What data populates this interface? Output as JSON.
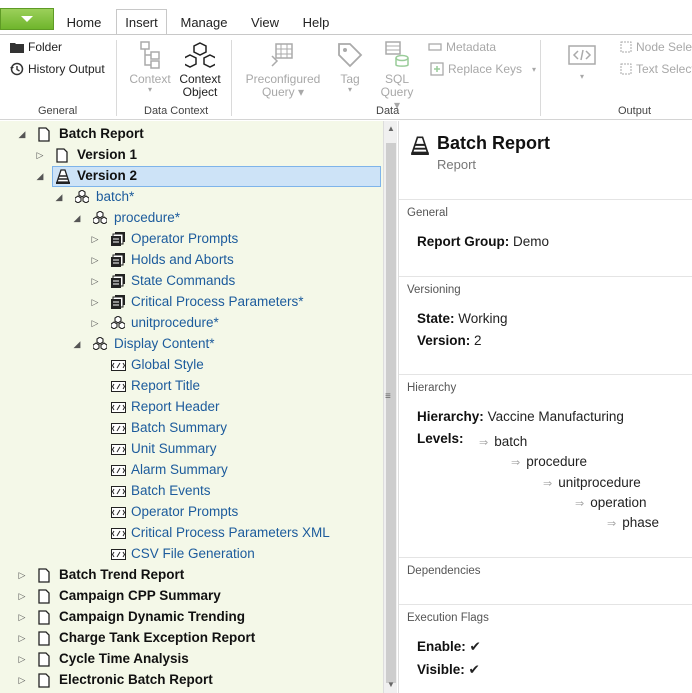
{
  "tabs": {
    "home": "Home",
    "insert": "Insert",
    "manage": "Manage",
    "view": "View",
    "help": "Help"
  },
  "ribbon": {
    "general": {
      "folder": "Folder",
      "history_output": "History Output",
      "label": "General"
    },
    "data_context": {
      "context_line1": "Context",
      "context_object_line1": "Context",
      "context_object_line2": "Object",
      "label": "Data Context"
    },
    "data": {
      "preconfigured_line1": "Preconfigured",
      "preconfigured_line2": "Query",
      "tag": "Tag",
      "sql_line1": "SQL",
      "sql_line2": "Query",
      "metadata": "Metadata",
      "replace_keys": "Replace Keys",
      "label": "Data"
    },
    "output": {
      "expression": "Expression",
      "node_select": "Node Selec",
      "text_select": "Text Select",
      "label": "Output"
    }
  },
  "tree": {
    "items": [
      {
        "label": "Batch Report"
      },
      {
        "label": "Version 1"
      },
      {
        "label": "Version 2"
      },
      {
        "label": "batch*"
      },
      {
        "label": "procedure*"
      },
      {
        "label": "Operator Prompts"
      },
      {
        "label": "Holds and Aborts"
      },
      {
        "label": "State Commands"
      },
      {
        "label": "Critical Process Parameters*"
      },
      {
        "label": "unitprocedure*"
      },
      {
        "label": "Display Content*"
      },
      {
        "label": "Global Style"
      },
      {
        "label": "Report Title"
      },
      {
        "label": "Report Header"
      },
      {
        "label": "Batch Summary"
      },
      {
        "label": "Unit Summary"
      },
      {
        "label": "Alarm Summary"
      },
      {
        "label": "Batch Events"
      },
      {
        "label": "Operator Prompts"
      },
      {
        "label": "Critical Process Parameters XML"
      },
      {
        "label": "CSV File Generation"
      },
      {
        "label": "Batch Trend Report"
      },
      {
        "label": "Campaign CPP Summary"
      },
      {
        "label": "Campaign Dynamic Trending"
      },
      {
        "label": "Charge Tank Exception Report"
      },
      {
        "label": "Cycle Time Analysis"
      },
      {
        "label": "Electronic Batch Report"
      }
    ]
  },
  "detail": {
    "title": "Batch Report",
    "subtitle": "Report",
    "general": {
      "header": "General",
      "report_group_label": "Report Group:",
      "report_group_value": "Demo"
    },
    "versioning": {
      "header": "Versioning",
      "state_label": "State:",
      "state_value": "Working",
      "version_label": "Version:",
      "version_value": "2"
    },
    "hierarchy": {
      "header": "Hierarchy",
      "hierarchy_label": "Hierarchy:",
      "hierarchy_value": "Vaccine Manufacturing",
      "levels_label": "Levels:",
      "levels": [
        "batch",
        "procedure",
        "unitprocedure",
        "operation",
        "phase"
      ]
    },
    "dependencies": {
      "header": "Dependencies"
    },
    "execution_flags": {
      "header": "Execution Flags",
      "enable_label": "Enable:",
      "enable_value": "✔",
      "visible_label": "Visible:",
      "visible_value": "✔"
    }
  }
}
